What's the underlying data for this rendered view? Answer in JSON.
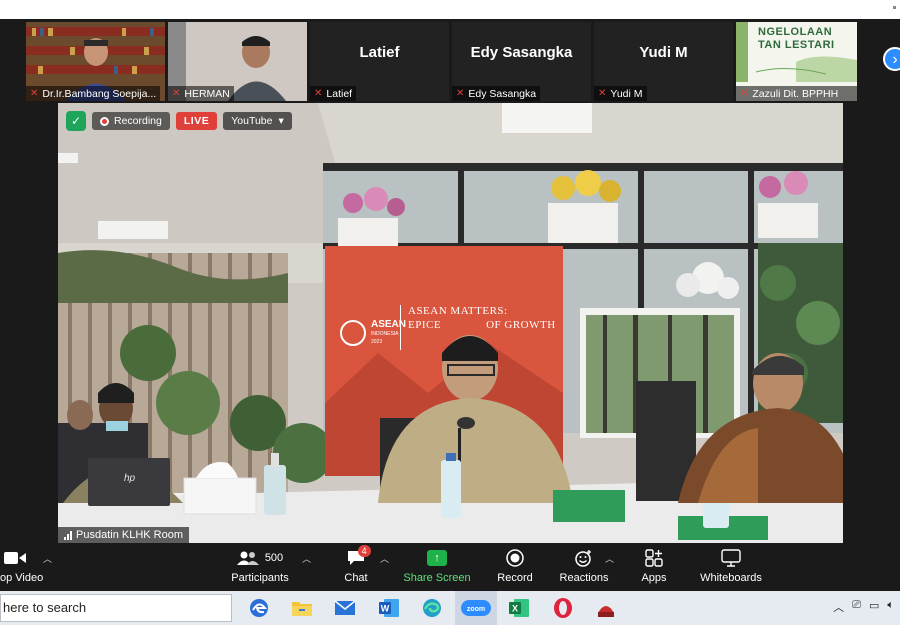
{
  "participants": [
    {
      "name": "Dr.Ir.Bambang Soepija...",
      "video": true
    },
    {
      "name": "HERMAN",
      "video": true
    },
    {
      "name": "Latief",
      "video": false
    },
    {
      "name": "Edy Sasangka",
      "video": false
    },
    {
      "name": "Yudi M",
      "video": false
    },
    {
      "name": "Zazuli Dit. BPPHH",
      "video": true
    }
  ],
  "zazuli_slide": {
    "line1": "NGELOLAAN",
    "line2": "TAN LESTARI"
  },
  "main_video": {
    "recording_label": "Recording",
    "live_label": "LIVE",
    "stream_target": "YouTube",
    "room_name": "Pusdatin KLHK Room",
    "banner_title": "ASEAN",
    "banner_sub": "INDONESIA",
    "banner_year": "2023",
    "banner_text_1": "ASEAN MATTERS:",
    "banner_text_2": "EPICE",
    "banner_text_3": "OF GROWTH",
    "laptop_logo": "hp"
  },
  "toolbar": {
    "video_label": "op Video",
    "participants_label": "Participants",
    "participants_count": "500",
    "chat_label": "Chat",
    "chat_badge": "4",
    "share_label": "Share Screen",
    "record_label": "Record",
    "reactions_label": "Reactions",
    "apps_label": "Apps",
    "whiteboards_label": "Whiteboards"
  },
  "taskbar": {
    "search_text": "here to search",
    "apps": [
      "edge-legacy",
      "file-explorer",
      "mail",
      "word",
      "edge",
      "zoom",
      "excel",
      "opera",
      "app"
    ],
    "zoom_label": "zoom"
  },
  "colors": {
    "accent_blue": "#2d8cff",
    "live_red": "#e0403a",
    "share_green": "#1fb24a"
  }
}
